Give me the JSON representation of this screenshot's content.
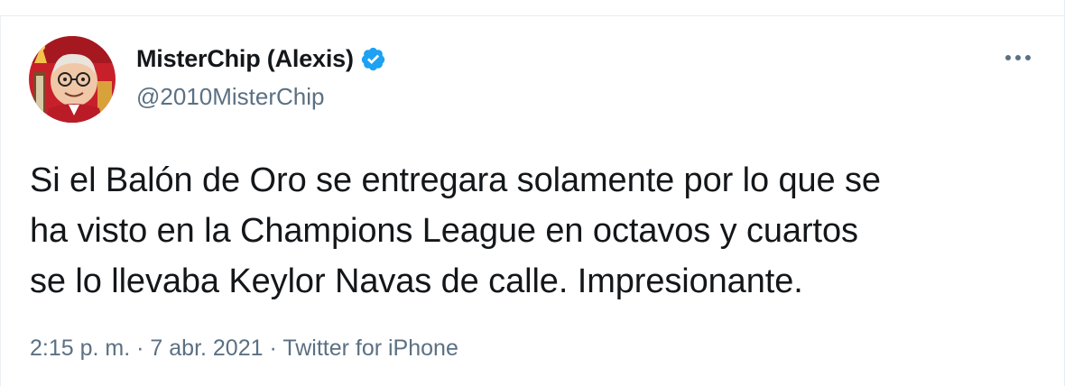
{
  "author": {
    "display_name": "MisterChip (Alexis)",
    "handle": "@2010MisterChip",
    "verified": true
  },
  "tweet": {
    "text_lines": [
      "Si el Balón de Oro se entregara solamente por lo que se",
      "ha visto en la Champions League en octavos y cuartos",
      "se lo llevaba Keylor Navas de calle. Impresionante."
    ]
  },
  "meta": {
    "time": "2:15 p. m.",
    "separator": "·",
    "date": "7 abr. 2021",
    "source": "Twitter for iPhone"
  },
  "icons": {
    "verified": "verified-badge-icon",
    "more": "more-options-icon"
  },
  "colors": {
    "verified_blue": "#1da1f2",
    "text_primary": "#14171a",
    "text_secondary": "#5b7083"
  }
}
